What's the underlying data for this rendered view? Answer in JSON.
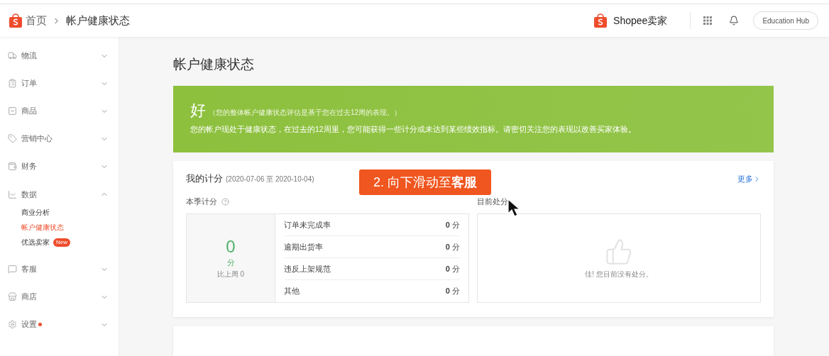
{
  "breadcrumb": {
    "home": "首页",
    "current": "帐户健康状态"
  },
  "header": {
    "brand": "Shopee卖家",
    "button": "Education Hub"
  },
  "sidebar": {
    "items": [
      {
        "kind": "logistics",
        "label": "物流",
        "expanded": false,
        "dot": false
      },
      {
        "kind": "orders",
        "label": "订单",
        "expanded": false,
        "dot": false
      },
      {
        "kind": "products",
        "label": "商品",
        "expanded": false,
        "dot": false
      },
      {
        "kind": "marketing",
        "label": "营销中心",
        "expanded": false,
        "dot": false
      },
      {
        "kind": "finance",
        "label": "财务",
        "expanded": false,
        "dot": false
      },
      {
        "kind": "data",
        "label": "数据",
        "expanded": true,
        "dot": false,
        "children": [
          {
            "label": "商业分析",
            "selected": false
          },
          {
            "label": "帐户健康状态",
            "selected": true
          },
          {
            "label": "优选卖家",
            "selected": false,
            "badge": "New"
          }
        ]
      },
      {
        "kind": "service",
        "label": "客服",
        "expanded": false,
        "dot": false
      },
      {
        "kind": "shop",
        "label": "商店",
        "expanded": false,
        "dot": false
      },
      {
        "kind": "settings",
        "label": "设置",
        "expanded": false,
        "dot": true
      }
    ]
  },
  "page_title": "帐户健康状态",
  "status": {
    "grade": "好",
    "note": "（您的整体帐户健康状态评估是基于您在过去12周的表现。）",
    "message": "您的帐户现处于健康状态，在过去的12周里，您可能获得一些计分或未达到某些绩效指标。请密切关注您的表现以改善买家体验。"
  },
  "points": {
    "title": "我的计分",
    "period": "(2020-07-06 至 2020-10-04)",
    "more": "更多",
    "season_label": "本季计分",
    "total": "0",
    "unit": "分",
    "compare": "比上周 0",
    "rows": [
      {
        "label": "订单未完成率",
        "value": "0",
        "unit": "分"
      },
      {
        "label": "逾期出货率",
        "value": "0",
        "unit": "分"
      },
      {
        "label": "违反上架规范",
        "value": "0",
        "unit": "分"
      },
      {
        "label": "其他",
        "value": "0",
        "unit": "分"
      }
    ],
    "penalty_label": "目前处分",
    "penalty_empty": "佳! 您目前没有处分。"
  },
  "callout": {
    "prefix": "2. 向下滑动至",
    "bold": "客服"
  }
}
